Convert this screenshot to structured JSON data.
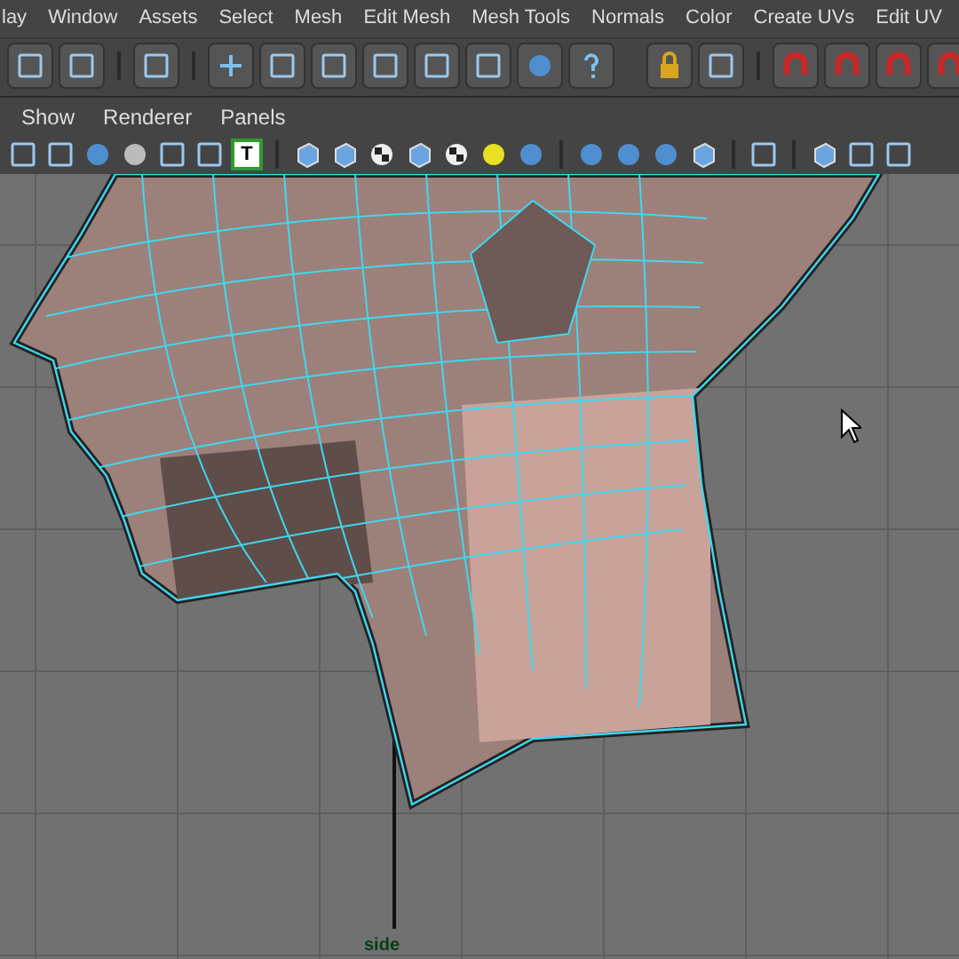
{
  "menu_bar": [
    "lay",
    "Window",
    "Assets",
    "Select",
    "Mesh",
    "Edit Mesh",
    "Mesh Tools",
    "Normals",
    "Color",
    "Create UVs",
    "Edit UV"
  ],
  "panel_menu": [
    "Show",
    "Renderer",
    "Panels"
  ],
  "panel_toolbar": {
    "text_icon": "T"
  },
  "viewport": {
    "camera_label": "side"
  }
}
